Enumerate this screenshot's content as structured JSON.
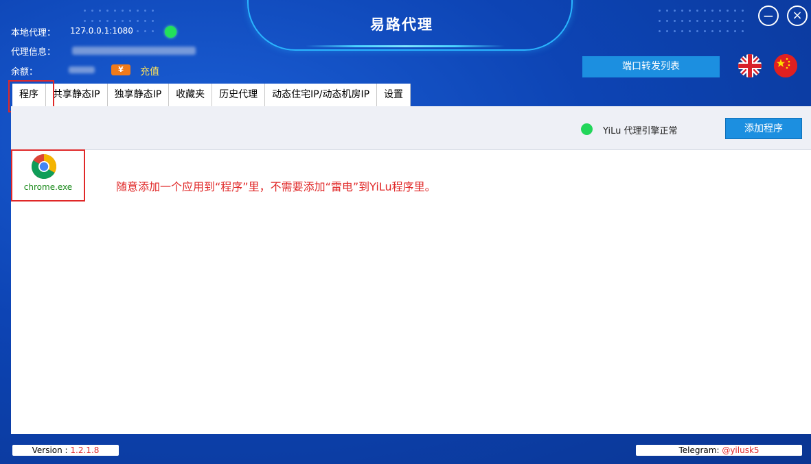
{
  "window": {
    "title": "易路代理",
    "minimize_icon": "minus-circle-icon",
    "close_icon": "x-circle-icon"
  },
  "info": {
    "local_proxy_label": "本地代理：",
    "local_proxy_value": "127.0.0.1:1080",
    "proxy_info_label": "代理信息：",
    "balance_label": "余额：",
    "currency_symbol": "¥",
    "recharge_label": "充值"
  },
  "toolbar_top": {
    "port_forward_label": "端口转发列表",
    "flags": [
      "uk-flag-icon",
      "china-flag-icon"
    ]
  },
  "tabs": [
    {
      "label": "程序",
      "active": true
    },
    {
      "label": "共享静态IP",
      "active": false
    },
    {
      "label": "独享静态IP",
      "active": false
    },
    {
      "label": "收藏夹",
      "active": false
    },
    {
      "label": "历史代理",
      "active": false
    },
    {
      "label": "动态住宅IP/动态机房IP",
      "active": false
    },
    {
      "label": "设置",
      "active": false
    }
  ],
  "panel": {
    "engine_status": "YiLu 代理引擎正常",
    "add_program_label": "添加程序",
    "apps": [
      {
        "name": "chrome.exe",
        "icon": "chrome-icon"
      }
    ],
    "note": "随意添加一个应用到“程序”里，不需要添加“雷电”到YiLu程序里。"
  },
  "footer": {
    "version_label": "Version : ",
    "version_value": "1.2.1.8",
    "telegram_label": "Telegram: ",
    "telegram_value": "@yilusk5"
  },
  "colors": {
    "background": "#0d44b4",
    "accent_blue": "#1c8fe0",
    "status_green": "#22e05a",
    "highlight_red": "#e02828",
    "recharge_yellow": "#ffe259"
  }
}
